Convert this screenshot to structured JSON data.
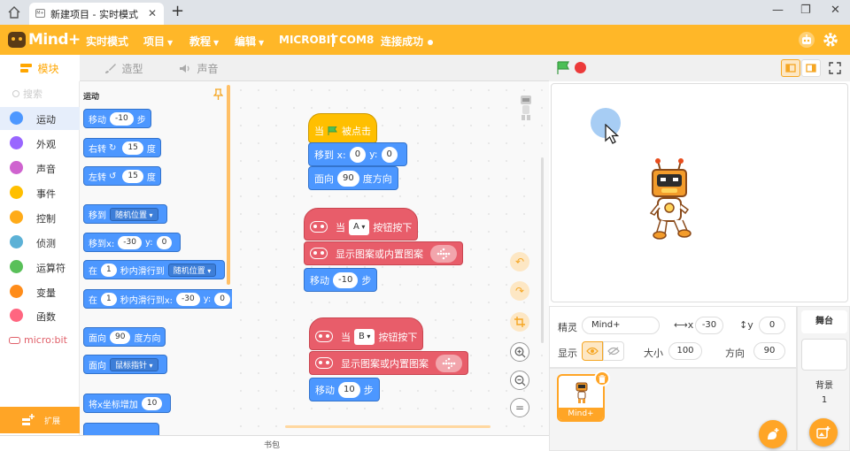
{
  "window": {
    "tab_title": "新建项目 - 实时模式",
    "tab_favicon": "M+",
    "close_glyph": "✕",
    "new_tab_glyph": "+",
    "minimize_glyph": "—",
    "restore_glyph": "❐",
    "close_window_glyph": "✕"
  },
  "menubar": {
    "logo_text": "Mind+",
    "mode": "实时模式",
    "project": "项目",
    "tutorial": "教程",
    "edit": "编辑",
    "device": "MICROBIT",
    "port": "COM8",
    "connection": "连接成功"
  },
  "tabs": {
    "code": "模块",
    "costumes": "造型",
    "sounds": "声音"
  },
  "categories": {
    "search_placeholder": "搜索",
    "items": [
      {
        "label": "运动",
        "color": "#4c97ff"
      },
      {
        "label": "外观",
        "color": "#9966ff"
      },
      {
        "label": "声音",
        "color": "#cf63cf"
      },
      {
        "label": "事件",
        "color": "#ffbf00"
      },
      {
        "label": "控制",
        "color": "#ffab19"
      },
      {
        "label": "侦测",
        "color": "#5cb1d6"
      },
      {
        "label": "运算符",
        "color": "#59c059"
      },
      {
        "label": "变量",
        "color": "#ff8c1a"
      },
      {
        "label": "函数",
        "color": "#ff6680"
      }
    ],
    "microbit": "micro:bit",
    "extensions": "扩展"
  },
  "palette": {
    "title": "运动",
    "b1": {
      "a": "移动",
      "v": "-10",
      "b": "步"
    },
    "b2": {
      "a": "右转",
      "v": "15",
      "b": "度",
      "glyph": "↻"
    },
    "b3": {
      "a": "左转",
      "v": "15",
      "b": "度",
      "glyph": "↺"
    },
    "b4": {
      "a": "移到",
      "d": "随机位置"
    },
    "b5": {
      "a": "移到x:",
      "x": "-30",
      "b": "y:",
      "y": "0"
    },
    "b6": {
      "a": "在",
      "v": "1",
      "b": "秒内滑行到",
      "d": "随机位置"
    },
    "b7": {
      "a": "在",
      "v": "1",
      "b": "秒内滑行到x:",
      "x": "-30",
      "c": "y:",
      "y": "0"
    },
    "b8": {
      "a": "面向",
      "v": "90",
      "b": "度方向"
    },
    "b9": {
      "a": "面向",
      "d": "鼠标指针"
    },
    "b10": {
      "a": "将x坐标增加",
      "v": "10"
    }
  },
  "script1": {
    "hat_a": "当",
    "hat_b": "被点击",
    "goto_a": "移到 x:",
    "goto_x": "0",
    "goto_b": "y:",
    "goto_y": "0",
    "point_a": "面向",
    "point_v": "90",
    "point_b": "度方向"
  },
  "script2": {
    "hat_a": "当",
    "button": "A",
    "hat_b": "按钮按下",
    "show": "显示图案或内置图案",
    "move_a": "移动",
    "move_v": "-10",
    "move_b": "步"
  },
  "script3": {
    "hat_a": "当",
    "button": "B",
    "hat_b": "按钮按下",
    "show": "显示图案或内置图案",
    "move_a": "移动",
    "move_v": "10",
    "move_b": "步"
  },
  "workspace_controls": {
    "undo": "↶",
    "redo": "↷",
    "zoom_in": "+",
    "zoom_out": "−",
    "reset": "="
  },
  "backpack": "书包",
  "sprite": {
    "name_label": "精灵",
    "name": "Mind+",
    "x_label": "x",
    "x": "-30",
    "y_label": "y",
    "y": "0",
    "show_label": "显示",
    "size_label": "大小",
    "size": "100",
    "direction_label": "方向",
    "direction": "90",
    "card_name": "Mind+"
  },
  "stage_panel": {
    "title": "舞台",
    "backdrop_label": "背景",
    "backdrop_count": "1"
  },
  "colors": {
    "accent": "#ffb728",
    "motion": "#4c97ff",
    "event": "#ffbf00",
    "microbit": "#e85d6a"
  }
}
